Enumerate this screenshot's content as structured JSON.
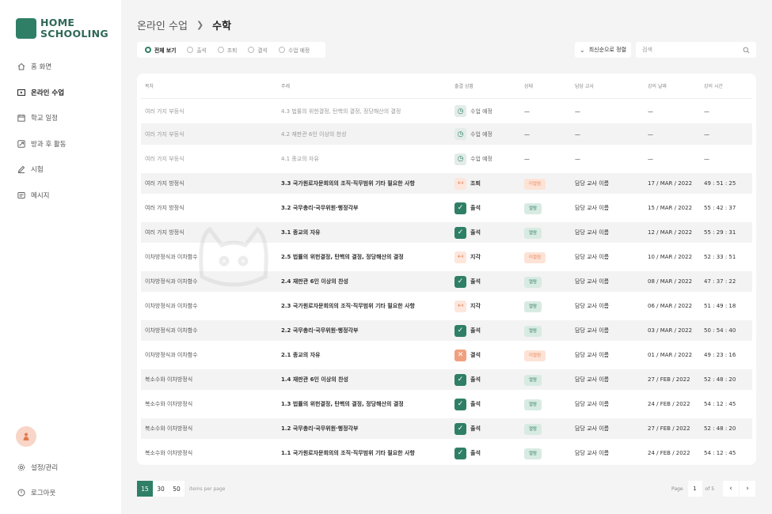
{
  "app": {
    "logo_line1": "HOME",
    "logo_line2": "SCHOOLING",
    "brand_color": "#2f7f66"
  },
  "sidebar": {
    "items": [
      {
        "label": "홈 화면",
        "icon": "home-icon"
      },
      {
        "label": "온라인 수업",
        "icon": "video-icon",
        "active": true
      },
      {
        "label": "학교 일정",
        "icon": "calendar-icon"
      },
      {
        "label": "방과 후 활동",
        "icon": "activity-icon"
      },
      {
        "label": "시험",
        "icon": "pencil-icon"
      },
      {
        "label": "메시지",
        "icon": "message-icon"
      }
    ],
    "bottom": [
      {
        "label": "설정/관리",
        "icon": "gear-icon"
      },
      {
        "label": "로그아웃",
        "icon": "power-icon"
      }
    ]
  },
  "breadcrumb": {
    "parent": "온라인 수업",
    "current": "수학"
  },
  "filters": [
    "전체 보기",
    "출석",
    "조퇴",
    "결석",
    "수업 예정"
  ],
  "sort": {
    "label": "최신순으로 정렬"
  },
  "search": {
    "placeholder": "검색"
  },
  "table": {
    "headers": [
      "목차",
      "주제",
      "출결 상황",
      "상태",
      "담당 교사",
      "강의 날짜",
      "강의 시간"
    ],
    "rows": [
      {
        "subject": "여러 가지 부등식",
        "title": "4.3 법률의 위헌결정, 탄핵의 결정, 정당해산의 결정",
        "att": "수업 예정",
        "att_type": "upcoming",
        "status": "—",
        "teacher": "—",
        "date": "—",
        "time": "—"
      },
      {
        "subject": "여러 가지 부등식",
        "title": "4.2 재판관 6인 이상의 찬성",
        "att": "수업 예정",
        "att_type": "upcoming",
        "status": "—",
        "teacher": "—",
        "date": "—",
        "time": "—"
      },
      {
        "subject": "여러 가지 부등식",
        "title": "4.1 종교의 자유",
        "att": "수업 예정",
        "att_type": "upcoming",
        "status": "—",
        "teacher": "—",
        "date": "—",
        "time": "—"
      },
      {
        "subject": "여러 가지 방정식",
        "title": "3.3 국가원로자문회의의 조직·직무범위 기타 필요한 사항",
        "att": "조퇴",
        "att_type": "late",
        "status": "미열람",
        "status_type": "orange",
        "teacher": "담당 교사 이름",
        "date": "17 / MAR / 2022",
        "time": "49 : 51 : 25"
      },
      {
        "subject": "여러 가지 방정식",
        "title": "3.2 국무총리·국무위원·행정각부",
        "att": "출석",
        "att_type": "present",
        "status": "열람",
        "status_type": "green",
        "teacher": "담당 교사 이름",
        "date": "15 / MAR / 2022",
        "time": "55 : 42 : 37"
      },
      {
        "subject": "여러 가지 방정식",
        "title": "3.1 종교의 자유",
        "att": "출석",
        "att_type": "present",
        "status": "열람",
        "status_type": "green",
        "teacher": "담당 교사 이름",
        "date": "12 / MAR / 2022",
        "time": "55 : 29 : 31"
      },
      {
        "subject": "이차방정식과 이차함수",
        "title": "2.5 법률의 위헌결정, 탄핵의 결정, 정당해산의 결정",
        "att": "지각",
        "att_type": "late",
        "status": "미열람",
        "status_type": "orange",
        "teacher": "담당 교사 이름",
        "date": "10 / MAR / 2022",
        "time": "52 : 33 : 51"
      },
      {
        "subject": "이차방정식과 이차함수",
        "title": "2.4 재판관 6인 이상의 찬성",
        "att": "출석",
        "att_type": "present",
        "status": "열람",
        "status_type": "green",
        "teacher": "담당 교사 이름",
        "date": "08 / MAR / 2022",
        "time": "47 : 37 : 22"
      },
      {
        "subject": "이차방정식과 이차함수",
        "title": "2.3 국가원로자문회의의 조직·직무범위 기타 필요한 사항",
        "att": "지각",
        "att_type": "late",
        "status": "열람",
        "status_type": "green",
        "teacher": "담당 교사 이름",
        "date": "06 / MAR / 2022",
        "time": "51 : 49 : 18"
      },
      {
        "subject": "이차방정식과 이차함수",
        "title": "2.2 국무총리·국무위원·행정각부",
        "att": "출석",
        "att_type": "present",
        "status": "열람",
        "status_type": "green",
        "teacher": "담당 교사 이름",
        "date": "03 / MAR / 2022",
        "time": "50 : 54 : 40"
      },
      {
        "subject": "이차방정식과 이차함수",
        "title": "2.1 종교의 자유",
        "att": "결석",
        "att_type": "absent",
        "status": "미열람",
        "status_type": "orange",
        "teacher": "담당 교사 이름",
        "date": "01 / MAR / 2022",
        "time": "49 : 23 : 16"
      },
      {
        "subject": "복소수와 이차방정식",
        "title": "1.4 재판관 6인 이상의 찬성",
        "att": "출석",
        "att_type": "present",
        "status": "열람",
        "status_type": "green",
        "teacher": "담당 교사 이름",
        "date": "27 / FEB / 2022",
        "time": "52 : 48 : 20"
      },
      {
        "subject": "복소수와 이차방정식",
        "title": "1.3 법률의 위헌결정, 탄핵의 결정, 정당해산의 결정",
        "att": "출석",
        "att_type": "present",
        "status": "열람",
        "status_type": "green",
        "teacher": "담당 교사 이름",
        "date": "24 / FEB / 2022",
        "time": "54 : 12 : 45"
      },
      {
        "subject": "복소수와 이차방정식",
        "title": "1.2 국무총리·국무위원·행정각부",
        "att": "출석",
        "att_type": "present",
        "status": "열람",
        "status_type": "green",
        "teacher": "담당 교사 이름",
        "date": "27 / FEB / 2022",
        "time": "52 : 48 : 20"
      },
      {
        "subject": "복소수와 이차방정식",
        "title": "1.1 국가원로자문회의의 조직·직무범위 기타 필요한 사항",
        "att": "출석",
        "att_type": "present",
        "status": "열람",
        "status_type": "green",
        "teacher": "담당 교사 이름",
        "date": "24 / FEB / 2022",
        "time": "54 : 12 : 45"
      }
    ]
  },
  "pagination": {
    "sizes": [
      "15",
      "30",
      "50"
    ],
    "per_page_label": "items per page",
    "page_label": "Page",
    "page": "1",
    "of_label": "of 5"
  }
}
